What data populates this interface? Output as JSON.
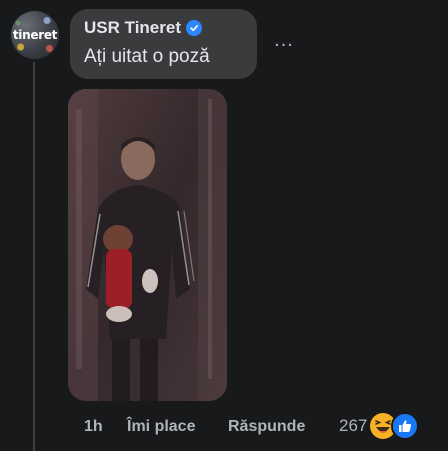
{
  "comment": {
    "avatar_text": "tineret",
    "author": "USR Tineret",
    "text": "Ați uitat o poză",
    "more_label": "..."
  },
  "actions": {
    "time": "1h",
    "like": "Îmi place",
    "reply": "Răspunde"
  },
  "reactions": {
    "count": "267",
    "icons": [
      "haha-icon",
      "like-icon"
    ]
  },
  "colors": {
    "background": "#18191a",
    "bubble": "#3a3b3c",
    "text_primary": "#e4e6eb",
    "text_secondary": "#b0b3b8",
    "verified": "#2d88ff"
  }
}
